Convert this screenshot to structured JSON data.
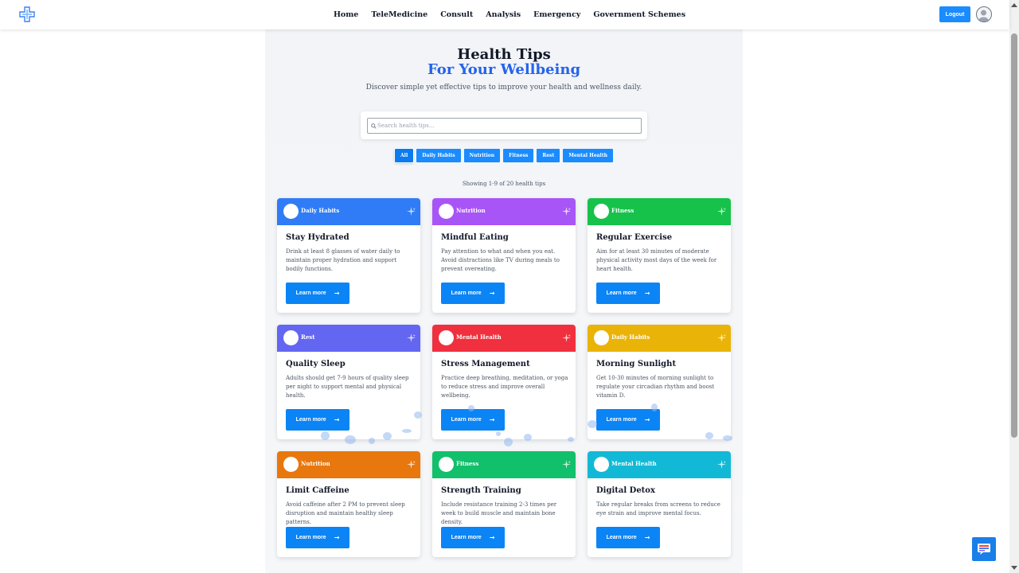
{
  "nav": {
    "links": [
      "Home",
      "TeleMedicine",
      "Consult",
      "Analysis",
      "Emergency",
      "Government Schemes"
    ],
    "logout": "Logout"
  },
  "hero": {
    "title": "Health Tips",
    "subtitle": "For Your Wellbeing",
    "description": "Discover simple yet effective tips to improve your health and wellness daily."
  },
  "search": {
    "placeholder": "Search health tips..."
  },
  "filters": [
    "All",
    "Daily Habits",
    "Nutrition",
    "Fitness",
    "Rest",
    "Mental Health"
  ],
  "active_filter": "All",
  "showing": "Showing 1-9 of 20 health tips",
  "cards": [
    {
      "category": "Daily Habits",
      "color": "#2f7cf6",
      "title": "Stay Hydrated",
      "text": "Drink at least 8 glasses of water daily to maintain proper hydration and support bodily functions.",
      "button": "Learn more"
    },
    {
      "category": "Nutrition",
      "color": "#a855f7",
      "title": "Mindful Eating",
      "text": "Pay attention to what and when you eat. Avoid distractions like TV during meals to prevent overeating.",
      "button": "Learn more"
    },
    {
      "category": "Fitness",
      "color": "#16c24a",
      "title": "Regular Exercise",
      "text": "Aim for at least 30 minutes of moderate physical activity most days of the week for heart health.",
      "button": "Learn more"
    },
    {
      "category": "Rest",
      "color": "#6366f1",
      "title": "Quality Sleep",
      "text": "Adults should get 7-9 hours of quality sleep per night to support mental and physical health.",
      "button": "Learn more"
    },
    {
      "category": "Mental Health",
      "color": "#f0303e",
      "title": "Stress Management",
      "text": "Practice deep breathing, meditation, or yoga to reduce stress and improve overall wellbeing.",
      "button": "Learn more"
    },
    {
      "category": "Daily Habits",
      "color": "#eab308",
      "title": "Morning Sunlight",
      "text": "Get 10-30 minutes of morning sunlight to regulate your circadian rhythm and boost vitamin D.",
      "button": "Learn more"
    },
    {
      "category": "Nutrition",
      "color": "#e8770e",
      "title": "Limit Caffeine",
      "text": "Avoid caffeine after 2 PM to prevent sleep disruption and maintain healthy sleep patterns.",
      "button": "Learn more"
    },
    {
      "category": "Fitness",
      "color": "#11c06a",
      "title": "Strength Training",
      "text": "Include resistance training 2-3 times per week to build muscle and maintain bone density.",
      "button": "Learn more"
    },
    {
      "category": "Mental Health",
      "color": "#12b9d6",
      "title": "Digital Detox",
      "text": "Take regular breaks from screens to reduce eye strain and improve mental focus.",
      "button": "Learn more"
    }
  ],
  "icons": {
    "logo": "medical-cross-icon",
    "avatar": "user-avatar-icon",
    "search": "search-icon",
    "card_spark": "sparkle-icon",
    "arrow": "arrow-right-icon",
    "chat": "chatbot-icon"
  }
}
